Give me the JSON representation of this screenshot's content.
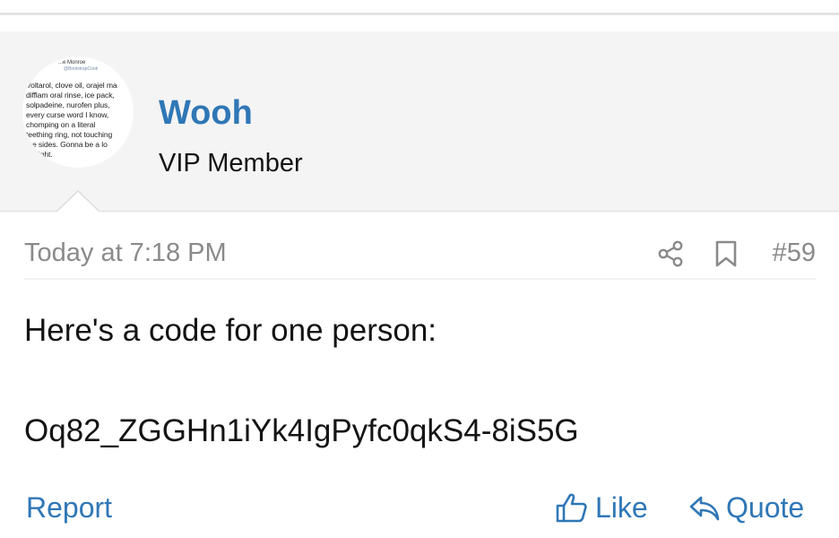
{
  "user": {
    "name": "Wooh",
    "title": "VIP Member",
    "avatar": {
      "header_name": "...e Monroe",
      "header_handle": "@BootstrapCook",
      "text": "Voltarol, clove oil, orajel ma\ndifflam oral rinse, ice pack,\nsolpadeine, nurofen plus,\nevery curse word I know,\nchomping on a literal\nteething ring, not touching\nthe sides. Gonna be a lo\n... night."
    }
  },
  "post": {
    "timestamp": "Today at 7:18 PM",
    "number": "#59",
    "message": {
      "line1": "Here's a code for one person:",
      "line2": "Oq82_ZGGHn1iYk4IgPyfc0qkS4-8iS5G"
    },
    "actions": {
      "report": "Report",
      "like": "Like",
      "quote": "Quote"
    }
  },
  "icons": {
    "share": "share-icon",
    "bookmark": "bookmark-icon",
    "like": "thumbs-up-icon",
    "quote": "reply-arrow-icon"
  },
  "colors": {
    "accent": "#2f77b6",
    "muted": "#8a8a8a",
    "user_block_bg": "#f4f4f4"
  }
}
